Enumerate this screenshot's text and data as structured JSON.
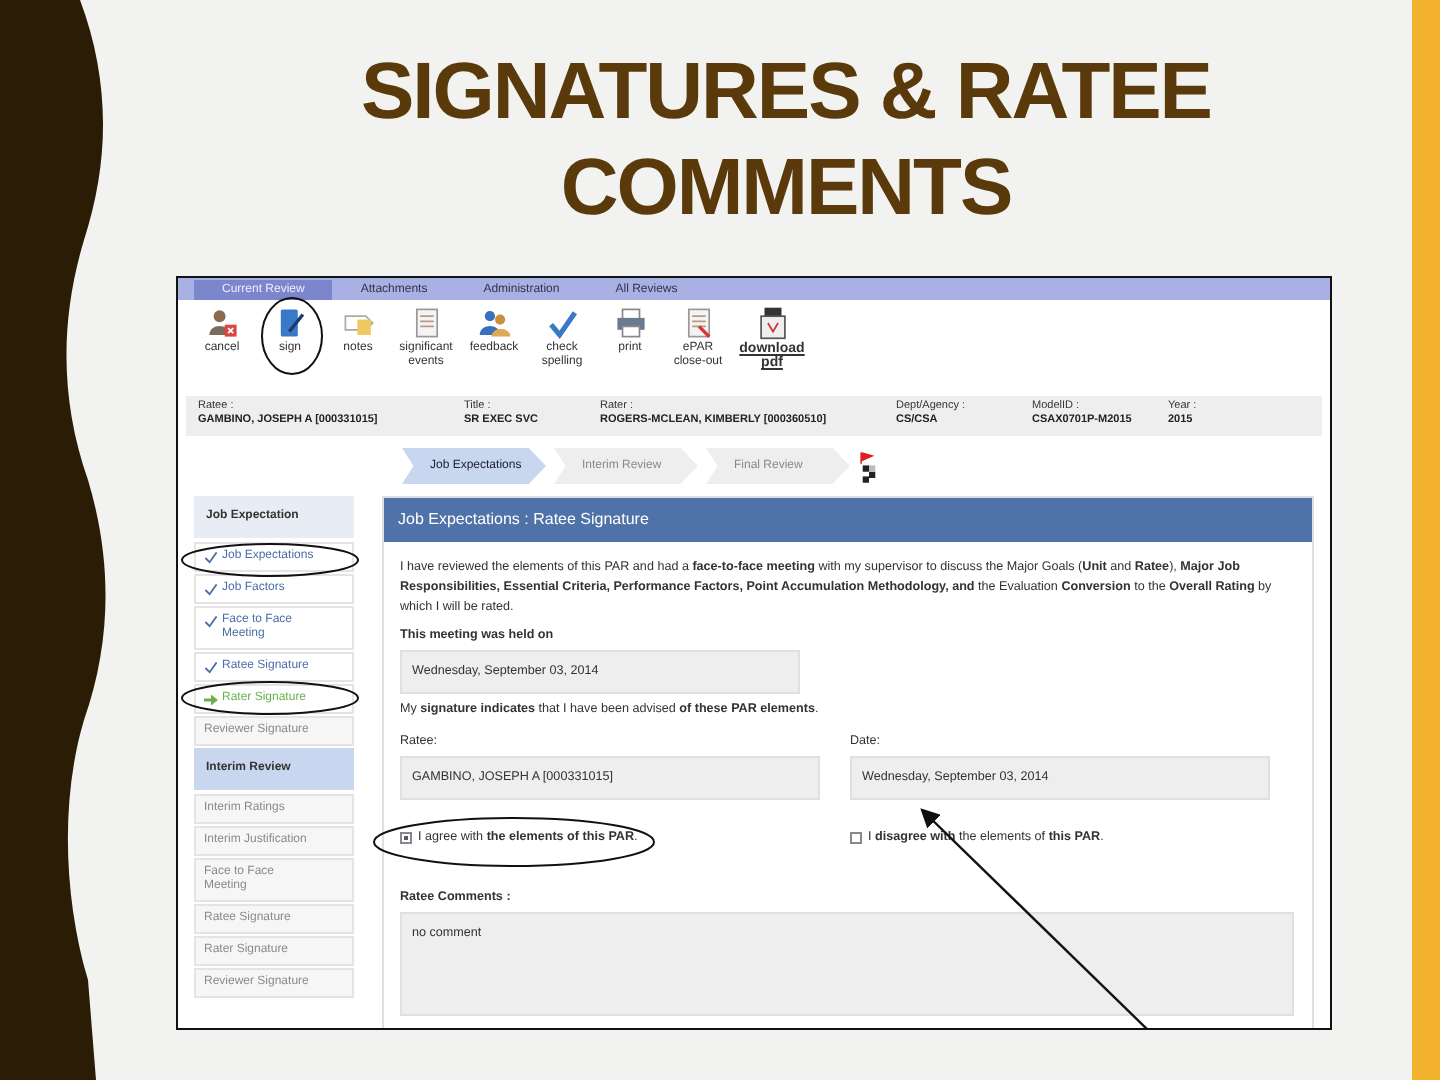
{
  "slide": {
    "title": "SIGNATURES & RATEE COMMENTS"
  },
  "screenshot": {
    "tabs": [
      {
        "label": "Current Review",
        "selected": true
      },
      {
        "label": "Attachments",
        "selected": false
      },
      {
        "label": "Administration",
        "selected": false
      },
      {
        "label": "All Reviews",
        "selected": false
      }
    ],
    "toolbar": [
      {
        "kind": "cancel",
        "label": "cancel",
        "link": false
      },
      {
        "kind": "sign",
        "label": "sign",
        "link": false
      },
      {
        "kind": "notes",
        "label": "notes",
        "link": false
      },
      {
        "kind": "events",
        "label": "significant events",
        "link": false
      },
      {
        "kind": "feedback",
        "label": "feedback",
        "link": false
      },
      {
        "kind": "spelling",
        "label": "check spelling",
        "link": false
      },
      {
        "kind": "print",
        "label": "print",
        "link": false
      },
      {
        "kind": "closeout",
        "label": "ePAR close-out",
        "link": false
      },
      {
        "kind": "pdf",
        "label": "download pdf",
        "link": true
      }
    ],
    "info": [
      {
        "label": "Ratee :",
        "value": "GAMBINO, JOSEPH A [000331015]"
      },
      {
        "label": "Title :",
        "value": "SR EXEC SVC"
      },
      {
        "label": "Rater :",
        "value": "ROGERS-MCLEAN, KIMBERLY [000360510]"
      },
      {
        "label": "Dept/Agency :",
        "value": "CS/CSA"
      },
      {
        "label": "ModelID :",
        "value": "CSAX0701P-M2015"
      },
      {
        "label": "Year :",
        "value": "2015"
      }
    ],
    "steps": [
      {
        "label": "Job Expectations",
        "selected": true
      },
      {
        "label": "Interim Review",
        "selected": false
      },
      {
        "label": "Final Review",
        "selected": false
      }
    ],
    "sidebar": [
      {
        "title": "Job Expectation",
        "selected": false,
        "items": [
          {
            "label": "Job Expectations",
            "kind": "done"
          },
          {
            "label": "Job Factors",
            "kind": "done"
          },
          {
            "label": "Face to Face Meeting",
            "kind": "done"
          },
          {
            "label": "Ratee Signature",
            "kind": "done"
          },
          {
            "label": "Rater Signature",
            "kind": "current"
          },
          {
            "label": "Reviewer Signature",
            "kind": "disabled"
          }
        ]
      },
      {
        "title": "Interim Review",
        "selected": true,
        "items": [
          {
            "label": "Interim Ratings",
            "kind": "disabled"
          },
          {
            "label": "Interim Justification",
            "kind": "disabled"
          },
          {
            "label": "Face to Face Meeting",
            "kind": "disabled"
          },
          {
            "label": "Ratee Signature",
            "kind": "disabled"
          },
          {
            "label": "Rater Signature",
            "kind": "disabled"
          },
          {
            "label": "Reviewer Signature",
            "kind": "disabled"
          }
        ]
      }
    ],
    "panel": {
      "heading": "Job Expectations : Ratee Signature",
      "statement": "I have reviewed the elements of this PAR and had a **face-to-face meeting** with my supervisor to discuss the Major Goals (**Unit** and **Ratee**), **Major Job Responsibilities, Essential Criteria, Performance Factors, Point Accumulation Methodology, and** the Evaluation **Conversion** to the **Overall Rating** by which I will be rated.",
      "meeting_label": "This meeting was held on",
      "meeting_date": "Wednesday, September 03, 2014",
      "signature_note": "My **signature indicates** that I have been advised **of these PAR elements**.",
      "ratee_label": "Ratee:",
      "ratee_value": "GAMBINO, JOSEPH A [000331015]",
      "date_label": "Date:",
      "date_value": "Wednesday, September 03, 2014",
      "agree": {
        "label": "I agree with **the elements of this PAR**.",
        "checked": true
      },
      "disagree": {
        "label": "I **disagree with** the elements of **this PAR**.",
        "checked": false
      },
      "comments_label": "Ratee Comments :",
      "comments_value": "no comment"
    }
  }
}
